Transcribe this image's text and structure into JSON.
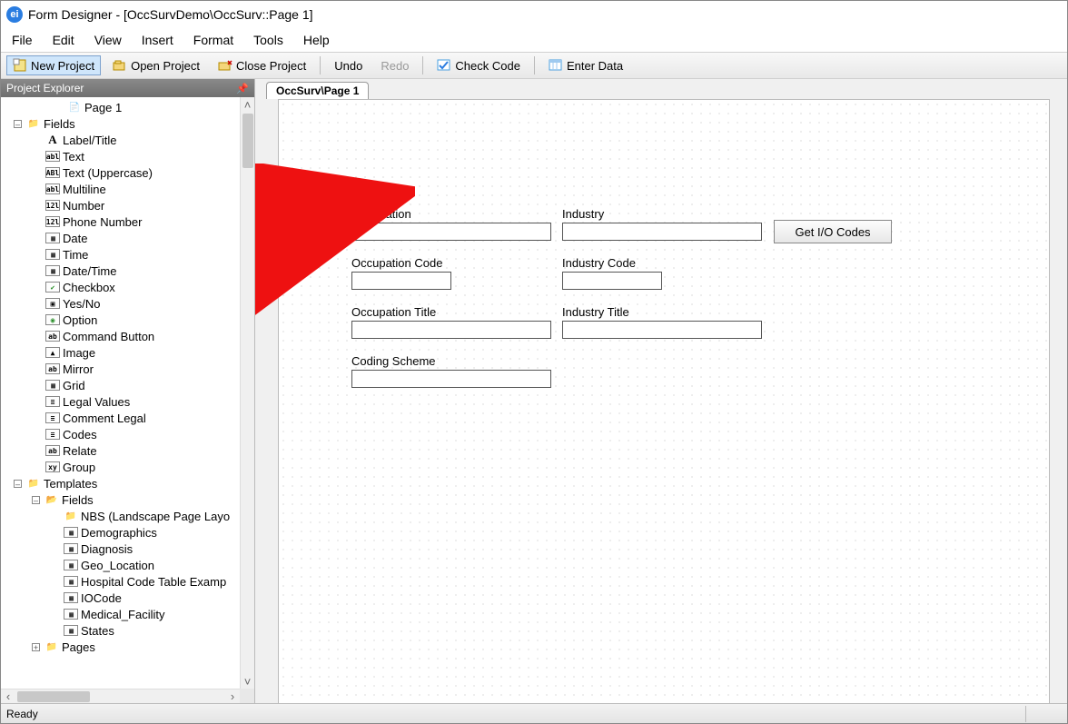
{
  "title": "Form Designer - [OccSurvDemo\\OccSurv::Page 1]",
  "menu": {
    "file": "File",
    "edit": "Edit",
    "view": "View",
    "insert": "Insert",
    "format": "Format",
    "tools": "Tools",
    "help": "Help"
  },
  "toolbar": {
    "new_project": "New Project",
    "open_project": "Open Project",
    "close_project": "Close Project",
    "undo": "Undo",
    "redo": "Redo",
    "check_code": "Check Code",
    "enter_data": "Enter Data"
  },
  "explorer": {
    "title": "Project Explorer",
    "page1": "Page 1",
    "fields": "Fields",
    "types": {
      "label_title": "Label/Title",
      "text": "Text",
      "text_upper": "Text (Uppercase)",
      "multiline": "Multiline",
      "number": "Number",
      "phone": "Phone Number",
      "date": "Date",
      "time": "Time",
      "datetime": "Date/Time",
      "checkbox": "Checkbox",
      "yesno": "Yes/No",
      "option": "Option",
      "command": "Command Button",
      "image": "Image",
      "mirror": "Mirror",
      "grid": "Grid",
      "legal": "Legal Values",
      "comment_legal": "Comment Legal",
      "codes": "Codes",
      "relate": "Relate",
      "group": "Group"
    },
    "templates": "Templates",
    "templates_fields": "Fields",
    "tpl": {
      "nbs": "NBS (Landscape Page Layo",
      "demographics": "Demographics",
      "diagnosis": "Diagnosis",
      "geo": "Geo_Location",
      "hospital": "Hospital Code Table Examp",
      "iocode": "IOCode",
      "medical": "Medical_Facility",
      "states": "States"
    },
    "pages": "Pages"
  },
  "tab_label": "OccSurv\\Page 1",
  "form": {
    "occupation": "Occupation",
    "industry": "Industry",
    "occupation_code": "Occupation Code",
    "industry_code": "Industry Code",
    "occupation_title": "Occupation Title",
    "industry_title": "Industry Title",
    "coding_scheme": "Coding Scheme",
    "get_io": "Get I/O Codes"
  },
  "status": "Ready"
}
